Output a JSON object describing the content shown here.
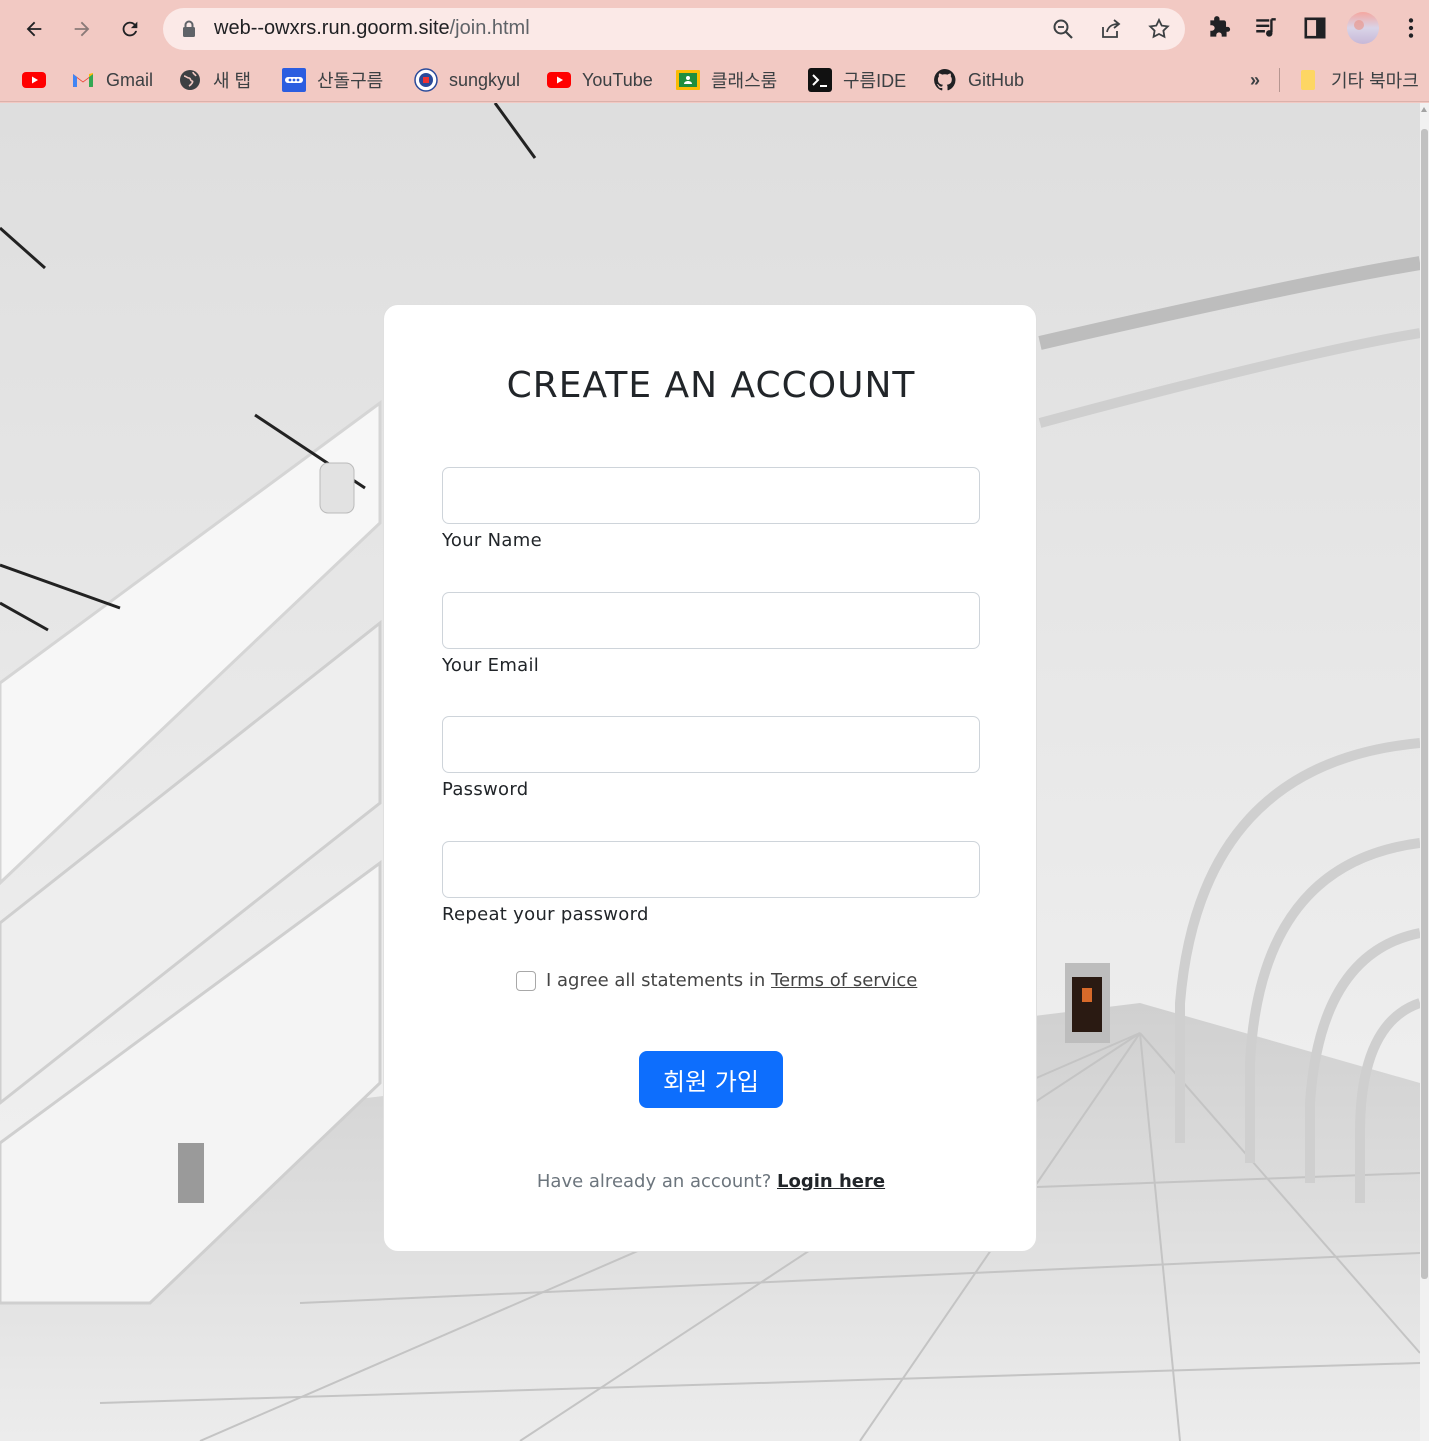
{
  "browser": {
    "url_host": "web--owxrs.run.goorm.site",
    "url_path": "/join.html",
    "bookmarks": [
      {
        "label": "",
        "icon": "youtube-icon"
      },
      {
        "label": "Gmail",
        "icon": "gmail-icon"
      },
      {
        "label": "새 탭",
        "icon": "globe-icon"
      },
      {
        "label": "산돌구름",
        "icon": "sandoll-icon"
      },
      {
        "label": "sungkyul",
        "icon": "university-seal-icon"
      },
      {
        "label": "YouTube",
        "icon": "youtube-icon"
      },
      {
        "label": "클래스룸",
        "icon": "classroom-icon"
      },
      {
        "label": "구름IDE",
        "icon": "terminal-icon"
      },
      {
        "label": "GitHub",
        "icon": "github-icon"
      }
    ],
    "overflow_label": "»",
    "other_bookmarks_label": "기타 북마크"
  },
  "form": {
    "title": "CREATE AN ACCOUNT",
    "fields": [
      {
        "label": "Your Name",
        "value": ""
      },
      {
        "label": "Your Email",
        "value": ""
      },
      {
        "label": "Password",
        "value": ""
      },
      {
        "label": "Repeat your password",
        "value": ""
      }
    ],
    "agree_text": "I agree all statements in ",
    "terms_link": "Terms of service",
    "agree_checked": false,
    "submit_label": "회원 가입",
    "login_prompt": "Have already an account? ",
    "login_link": "Login here"
  },
  "colors": {
    "chrome_bg": "#f2c9c3",
    "omnibox_bg": "#fbe9e7",
    "primary_button": "#0d6efd"
  }
}
